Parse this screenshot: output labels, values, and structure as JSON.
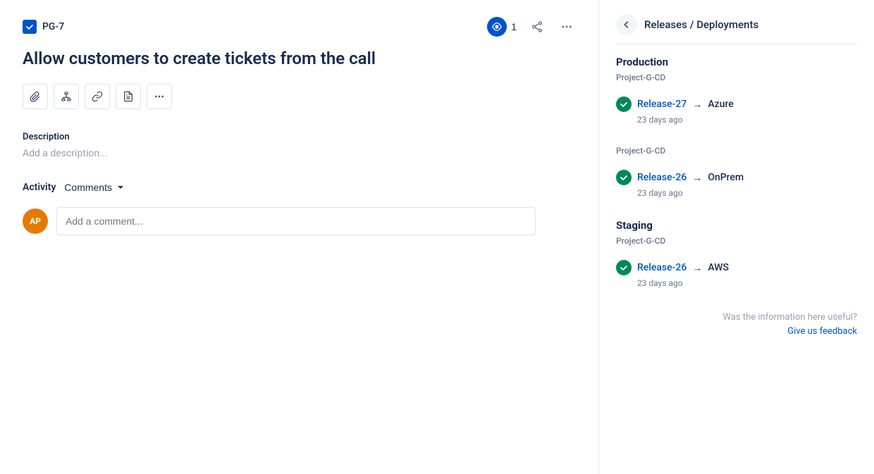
{
  "header": {
    "ticket_id": "PG-7",
    "watch_count": "1",
    "share_label": "share",
    "more_label": "more"
  },
  "page": {
    "title": "Allow customers to create tickets from the call"
  },
  "toolbar": {
    "attachment_label": "attachment",
    "hierarchy_label": "hierarchy",
    "link_label": "link",
    "document_label": "document",
    "more_label": "more"
  },
  "description": {
    "section_title": "Description",
    "placeholder": "Add a description..."
  },
  "activity": {
    "label": "Activity",
    "filter_label": "Comments",
    "comment_placeholder": "Add a comment...",
    "avatar_initials": "AP"
  },
  "right_panel": {
    "title": "Releases / Deployments",
    "back_label": "back",
    "environments": [
      {
        "name": "Production",
        "project": "Project-G-CD",
        "releases": [
          {
            "release": "Release-27",
            "target": "Azure",
            "time": "23 days ago"
          }
        ]
      },
      {
        "name": "",
        "project": "Project-G-CD",
        "releases": [
          {
            "release": "Release-26",
            "target": "OnPrem",
            "time": "23 days ago"
          }
        ]
      },
      {
        "name": "Staging",
        "project": "Project-G-CD",
        "releases": [
          {
            "release": "Release-26",
            "target": "AWS",
            "time": "23 days ago"
          }
        ]
      }
    ],
    "feedback_text": "Was the information here useful?",
    "feedback_link": "Give us feedback"
  },
  "colors": {
    "accent_blue": "#0052cc",
    "green": "#00875a",
    "orange": "#e47b00",
    "gray_border": "#e8e8e8",
    "light_bg": "#f4f5f7"
  }
}
